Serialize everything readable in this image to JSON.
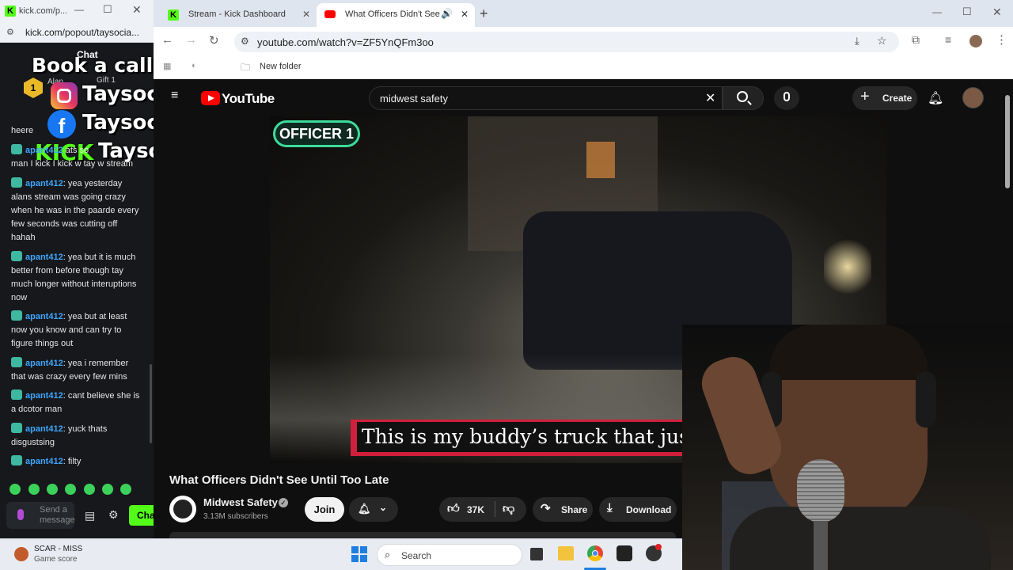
{
  "popout": {
    "url_short": "kick.com/p...",
    "url_full": "kick.com/popout/taysocia...",
    "chat_label": "Chat",
    "gift_label": "Gift 1",
    "top_user": "Alan",
    "top_num": "1",
    "overlay": {
      "book": "Book a call at",
      "instagram": "Taysocial",
      "facebook": "TaysocialFB",
      "kick_word": "KICK",
      "kick_handle": "Taysocial"
    },
    "messages": [
      {
        "user": "",
        "text": "heere"
      },
      {
        "user": "apant412",
        "text": "man I kick I kick w tay w stream",
        "prefix": ""
      },
      {
        "user": "apant412",
        "text": "yea yesterday alans stream was going crazy when he was in the paarde every few seconds was cutting off hahah"
      },
      {
        "user": "apant412",
        "text": "yea but it is much better from before though tay much longer without interuptions now"
      },
      {
        "user": "apant412",
        "text": "yea but at least now you know and can try to figure things out"
      },
      {
        "user": "apant412",
        "text": "yea i remember that was crazy every few mins"
      },
      {
        "user": "apant412",
        "text": "cant believe she is a dcotor man"
      },
      {
        "user": "apant412",
        "text": "yuck thats disgustsing"
      },
      {
        "user": "apant412",
        "text": "filty"
      }
    ],
    "partial_line": "ats so",
    "send_placeholder": "Send a message",
    "chat_button": "Cha"
  },
  "browser": {
    "tabs": [
      {
        "title": "Stream - Kick Dashboard",
        "active": false
      },
      {
        "title": "What Officers Didn't See U",
        "active": true
      }
    ],
    "url": "youtube.com/watch?v=ZF5YnQFm3oo",
    "bookmark": "New folder"
  },
  "youtube": {
    "logo_text": "YouTube",
    "search_query": "midwest safety",
    "create_label": "Create",
    "video_badge": "OFFICER 1",
    "subtitle": "This is my buddy’s truck that just... away",
    "video_title": "What Officers Didn't See Until Too Late",
    "channel_name": "Midwest Safety",
    "subscribers": "3.13M subscribers",
    "join_label": "Join",
    "likes": "37K",
    "share_label": "Share",
    "download_label": "Download"
  },
  "taskbar": {
    "game_title": "SCAR - MISS",
    "game_sub": "Game score",
    "search_label": "Search"
  },
  "colors": {
    "kick_green": "#53fc18",
    "youtube_red": "#ff0000",
    "subtitle_red": "#d01f3c",
    "badge_teal": "#3fb8a1",
    "username_blue": "#3ea6ff"
  }
}
